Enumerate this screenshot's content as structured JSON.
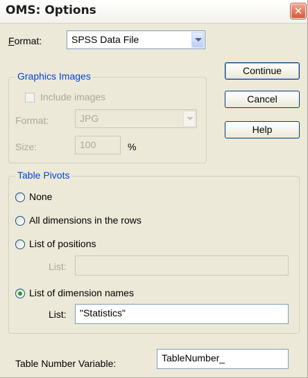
{
  "window": {
    "title": "OMS: Options",
    "close_glyph": "✕"
  },
  "format": {
    "label": "Format:",
    "value": "SPSS Data File"
  },
  "buttons": {
    "continue": "Continue",
    "cancel": "Cancel",
    "help": "Help"
  },
  "graphics": {
    "legend": "Graphics Images",
    "include_label": "Include images",
    "format_label": "Format:",
    "format_value": "JPG",
    "size_label": "Size:",
    "size_value": "100",
    "size_unit": "%"
  },
  "pivots": {
    "legend": "Table Pivots",
    "none": "None",
    "all_dims": "All dimensions in the rows",
    "positions": "List of positions",
    "positions_list_label": "List:",
    "positions_list_value": "",
    "dim_names": "List of dimension names",
    "dim_list_label": "List:",
    "dim_list_value": "\"Statistics\"",
    "selected": "dim_names"
  },
  "table_number": {
    "label": "Table Number Variable:",
    "value": "TableNumber_"
  }
}
